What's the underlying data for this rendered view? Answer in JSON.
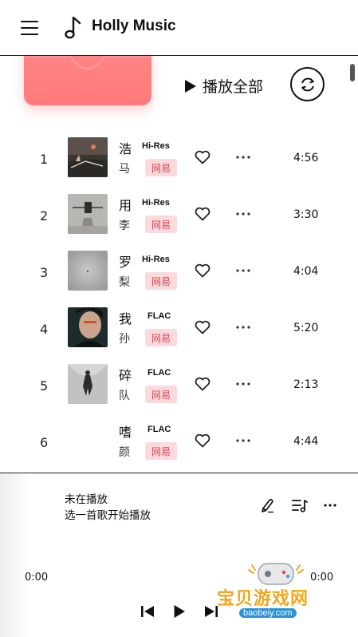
{
  "header": {
    "title": "Holly Music"
  },
  "toolbar": {
    "play_all_label": "播放全部"
  },
  "songs": [
    {
      "no": "1",
      "title": "浩",
      "artist": "马",
      "quality": "Hi-Res",
      "source": "网易",
      "duration": "4:56"
    },
    {
      "no": "2",
      "title": "用",
      "artist": "李",
      "quality": "Hi-Res",
      "source": "网易",
      "duration": "3:30"
    },
    {
      "no": "3",
      "title": "罗",
      "artist": "梨",
      "quality": "Hi-Res",
      "source": "网易",
      "duration": "4:04"
    },
    {
      "no": "4",
      "title": "我",
      "artist": "孙",
      "quality": "FLAC",
      "source": "网易",
      "duration": "5:20"
    },
    {
      "no": "5",
      "title": "碎",
      "artist": "队",
      "quality": "FLAC",
      "source": "网易",
      "duration": "2:13"
    },
    {
      "no": "6",
      "title": "嗜",
      "artist": "颜",
      "quality": "FLAC",
      "source": "网易",
      "duration": "4:44"
    }
  ],
  "player": {
    "status": "未在播放",
    "hint": "选一首歌开始播放",
    "current_time": "0:00",
    "total_time": "0:00"
  },
  "watermark": {
    "main": "宝贝游戏网",
    "sub": "baobeiy.com"
  },
  "colors": {
    "accent": "#ff7a7c",
    "badge_bg": "#fcd9dd",
    "badge_text": "#d64a5b"
  },
  "icons": {
    "menu": "hamburger-menu-icon",
    "logo": "music-note-icon",
    "refresh": "refresh-icon",
    "like": "heart-icon",
    "more": "more-dots-icon",
    "lyrics": "pen-icon",
    "queue": "playlist-icon",
    "prev": "skip-previous-icon",
    "play": "play-icon",
    "next": "skip-next-icon"
  }
}
